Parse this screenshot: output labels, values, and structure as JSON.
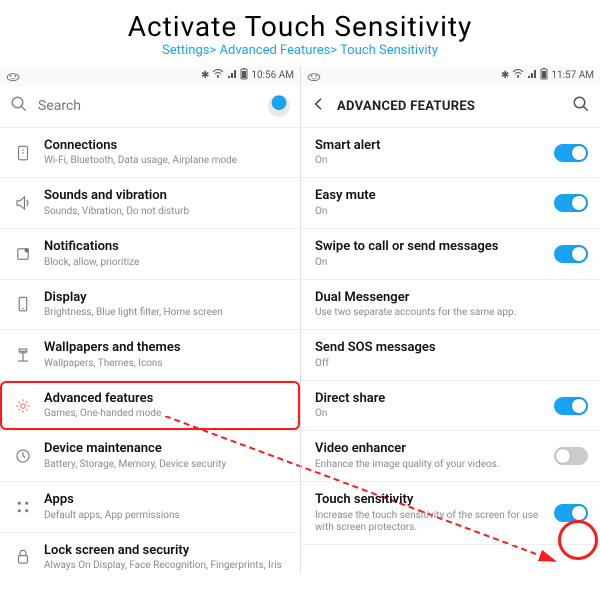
{
  "title": "Activate Touch Sensitivity",
  "breadcrumb": "Settings> Advanced Features> Touch\nSensitivity",
  "left": {
    "status_time": "10:56 AM",
    "search_placeholder": "Search",
    "items": [
      {
        "icon": "network",
        "title": "Connections",
        "sub": "Wi-Fi, Bluetooth, Data usage, Airplane mode"
      },
      {
        "icon": "sound",
        "title": "Sounds and vibration",
        "sub": "Sounds, Vibration, Do not disturb"
      },
      {
        "icon": "notif",
        "title": "Notifications",
        "sub": "Block, allow, prioritize"
      },
      {
        "icon": "display",
        "title": "Display",
        "sub": "Brightness, Blue light filter, Home screen"
      },
      {
        "icon": "wall",
        "title": "Wallpapers and themes",
        "sub": "Wallpapers, Themes, Icons"
      },
      {
        "icon": "adv",
        "title": "Advanced features",
        "sub": "Games, One-handed mode"
      },
      {
        "icon": "maint",
        "title": "Device maintenance",
        "sub": "Battery, Storage, Memory, Device security"
      },
      {
        "icon": "apps",
        "title": "Apps",
        "sub": "Default apps, App permissions"
      },
      {
        "icon": "lock",
        "title": "Lock screen and security",
        "sub": "Always On Display, Face Recognition, Fingerprints, Iris"
      }
    ]
  },
  "right": {
    "status_time": "11:57 AM",
    "header": "ADVANCED FEATURES",
    "items": [
      {
        "title": "Smart alert",
        "sub": "On",
        "toggle": "on"
      },
      {
        "title": "Easy mute",
        "sub": "On",
        "toggle": "on"
      },
      {
        "title": "Swipe to call or send messages",
        "sub": "On",
        "toggle": "on"
      },
      {
        "title": "Dual Messenger",
        "sub": "Use two separate accounts for the same app.",
        "toggle": ""
      },
      {
        "title": "Send SOS messages",
        "sub": "Off",
        "toggle": ""
      },
      {
        "title": "Direct share",
        "sub": "On",
        "toggle": "on"
      },
      {
        "title": "Video enhancer",
        "sub": "Enhance the image quality of your videos.",
        "toggle": "off"
      },
      {
        "title": "Touch sensitivity",
        "sub": "Increase the touch sensitivity of the screen for use with screen protectors.",
        "toggle": "on"
      }
    ]
  }
}
